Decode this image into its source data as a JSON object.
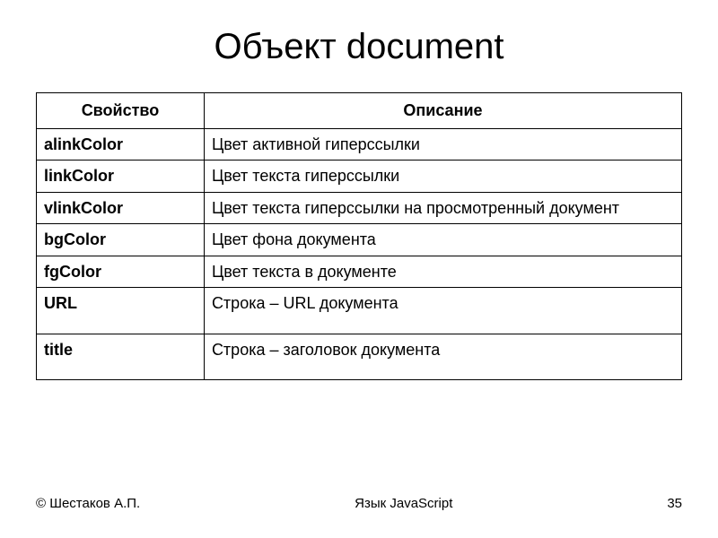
{
  "title": "Объект document",
  "table": {
    "headers": {
      "property": "Свойство",
      "description": "Описание"
    },
    "rows": [
      {
        "prop": "alinkColor",
        "desc": "Цвет активной гиперссылки",
        "tall": false
      },
      {
        "prop": "linkColor",
        "desc": "Цвет текста гиперссылки",
        "tall": false
      },
      {
        "prop": "vlinkColor",
        "desc": "Цвет текста гиперссылки на просмотренный документ",
        "tall": false
      },
      {
        "prop": "bgColor",
        "desc": "Цвет фона документа",
        "tall": false
      },
      {
        "prop": "fgColor",
        "desc": "Цвет текста в документе",
        "tall": false
      },
      {
        "prop": "URL",
        "desc": "Строка – URL документа",
        "tall": true
      },
      {
        "prop": "title",
        "desc": "Строка – заголовок документа",
        "tall": true
      }
    ]
  },
  "footer": {
    "author": "© Шестаков А.П.",
    "subject": "Язык JavaScript",
    "page": "35"
  }
}
